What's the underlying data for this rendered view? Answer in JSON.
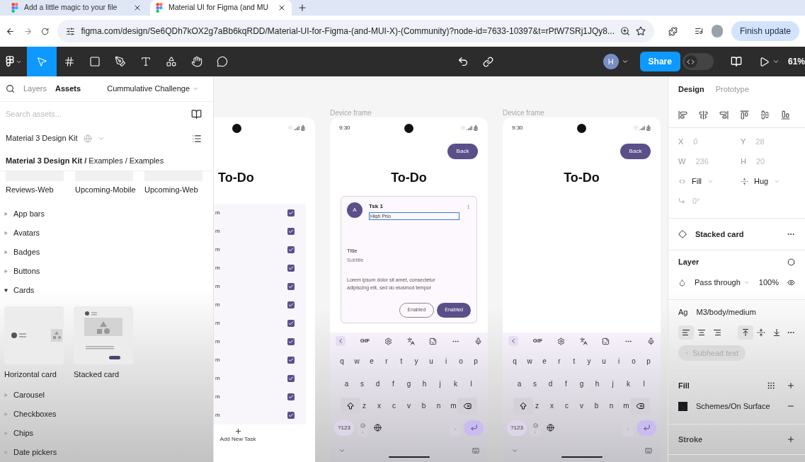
{
  "browser": {
    "tabs": [
      {
        "title": "Add a little magic to your file",
        "selected": false
      },
      {
        "title": "Material UI for Figma (and MU",
        "selected": true
      }
    ],
    "url": "figma.com/design/Se6QDh7kOX2g7aBb6kqRDD/Material-UI-for-Figma-(and-MUI-X)-(Community)?node-id=7633-10397&t=rPtW7SRj1JQy8...",
    "update_button": "Finish update"
  },
  "toolbar": {
    "tools": [
      {
        "kind": "move",
        "selected": true
      },
      {
        "kind": "frame",
        "selected": false
      },
      {
        "kind": "shape",
        "selected": false
      },
      {
        "kind": "pen",
        "selected": false
      },
      {
        "kind": "text",
        "selected": false
      },
      {
        "kind": "resources",
        "selected": false
      },
      {
        "kind": "hand",
        "selected": false
      },
      {
        "kind": "comment",
        "selected": false
      }
    ],
    "avatar": "H",
    "share": "Share",
    "dev_mode_on": false,
    "zoom": "61%"
  },
  "left_panel": {
    "tabs": [
      {
        "label": "Layers",
        "selected": false
      },
      {
        "label": "Assets",
        "selected": true
      }
    ],
    "file": "Cummulative Challenge",
    "search": {
      "placeholder": "Search assets..."
    },
    "library": "Material 3 Design Kit",
    "breadcrumb": "**Material 3 Design Kit /** Examples / Examples",
    "thumbnails": [
      "Reviews-Web",
      "Upcoming-Mobile",
      "Upcoming-Web"
    ],
    "sections": [
      {
        "label": "App bars",
        "expanded": false
      },
      {
        "label": "Avatars",
        "expanded": false
      },
      {
        "label": "Badges",
        "expanded": false
      },
      {
        "label": "Buttons",
        "expanded": false
      },
      {
        "label": "Cards",
        "expanded": true,
        "components": [
          {
            "label": "Horizontal card",
            "kind": "horizontal"
          },
          {
            "label": "Stacked card",
            "kind": "stacked"
          }
        ]
      },
      {
        "label": "Carousel",
        "expanded": false
      },
      {
        "label": "Checkboxes",
        "expanded": false
      },
      {
        "label": "Chips",
        "expanded": false
      },
      {
        "label": "Date pickers",
        "expanded": false
      }
    ]
  },
  "canvas": {
    "frames": [
      {
        "kind": "list",
        "title": "To-Do",
        "rows": [
          {
            "text": "m",
            "checked": true
          },
          {
            "text": "m",
            "checked": true
          },
          {
            "text": "m",
            "checked": true
          },
          {
            "text": "m",
            "checked": true
          },
          {
            "text": "m",
            "checked": true
          },
          {
            "text": "m",
            "checked": true
          },
          {
            "text": "m",
            "checked": true
          },
          {
            "text": "m",
            "checked": true
          },
          {
            "text": "m",
            "checked": true
          },
          {
            "text": "m",
            "checked": true
          },
          {
            "text": "m",
            "checked": true
          },
          {
            "text": "m",
            "checked": true
          }
        ],
        "add_label": "Add New Task"
      },
      {
        "kind": "edit",
        "label": "Device frame",
        "time": "9:30",
        "back": "Back",
        "title": "To-Do",
        "card": {
          "avatar": "A",
          "heading": "Tsk 1",
          "input_value": "High Prio",
          "title": "Title",
          "subtitle": "Subtitle",
          "body": "Lorem ipsum dolor sit amet, consectetur adipiscing elit, sed do eiusmod tempor",
          "buttons": [
            {
              "label": "Enabled",
              "kind": "outlined"
            },
            {
              "label": "Enabled",
              "kind": "filled"
            }
          ]
        },
        "keyboard": {
          "gif": "GIF",
          "rows": [
            [
              "q",
              "w",
              "e",
              "r",
              "t",
              "y",
              "u",
              "i",
              "o",
              "p"
            ],
            [
              "a",
              "s",
              "d",
              "f",
              "g",
              "h",
              "j",
              "k",
              "l"
            ],
            [
              "z",
              "x",
              "c",
              "v",
              "b",
              "n",
              "m"
            ]
          ],
          "symbols": "?123",
          "comma": ",",
          "period": "."
        }
      },
      {
        "kind": "edit",
        "label": "Device frame",
        "time": "9:30",
        "back": "Back",
        "title": "To-Do",
        "keyboard": {
          "gif": "GIF",
          "rows": [
            [
              "q",
              "w",
              "e",
              "r",
              "t",
              "y",
              "u",
              "i",
              "o",
              "p"
            ],
            [
              "a",
              "s",
              "d",
              "f",
              "g",
              "h",
              "j",
              "k",
              "l"
            ],
            [
              "z",
              "x",
              "c",
              "v",
              "b",
              "n",
              "m"
            ]
          ],
          "symbols": "?123",
          "comma": ",",
          "period": "."
        }
      }
    ]
  },
  "right_panel": {
    "tabs": [
      {
        "label": "Design",
        "selected": true
      },
      {
        "label": "Prototype",
        "selected": false
      }
    ],
    "fields": [
      {
        "label": "X",
        "value": "0"
      },
      {
        "label": "Y",
        "value": "28"
      },
      {
        "label": "W",
        "value": "236"
      },
      {
        "label": "H",
        "value": "20"
      }
    ],
    "sizing": [
      "Fill",
      "Hug"
    ],
    "rotation": "0°",
    "component": "Stacked card",
    "layer": {
      "title": "Layer",
      "blend": "Pass through",
      "opacity": "100%"
    },
    "text": {
      "style_icon": "Ag",
      "style": "M3/body/medium",
      "align": [
        {
          "kind": "left",
          "selected": true
        },
        {
          "kind": "center",
          "selected": false
        },
        {
          "kind": "right",
          "selected": false
        }
      ],
      "valign": [
        {
          "kind": "top",
          "selected": true
        },
        {
          "kind": "middle",
          "selected": false
        },
        {
          "kind": "bottom",
          "selected": false
        }
      ],
      "chip": "Subhead text"
    },
    "fill": {
      "title": "Fill",
      "name": "Schemes/On Surface"
    },
    "stroke": "Stroke"
  }
}
